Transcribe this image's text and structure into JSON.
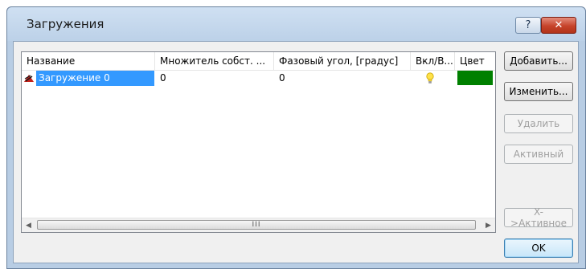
{
  "window": {
    "title": "Загружения",
    "help_label": "?",
    "close_label": "✕"
  },
  "table": {
    "columns": [
      "Название",
      "Множитель собст. ...",
      "Фазовый угол, [градус]",
      "Вкл/В...",
      "Цвет"
    ],
    "rows": [
      {
        "name": "Загружение 0",
        "multiplier": "0",
        "phase": "0",
        "enabled": "bulb-on-icon",
        "color": "#008000"
      }
    ],
    "scroll_grip": "III"
  },
  "buttons": {
    "add": "Добавить...",
    "edit": "Изменить...",
    "delete": "Удалить",
    "active": "Активный",
    "x_active": "X->Активное",
    "ok": "OK"
  }
}
